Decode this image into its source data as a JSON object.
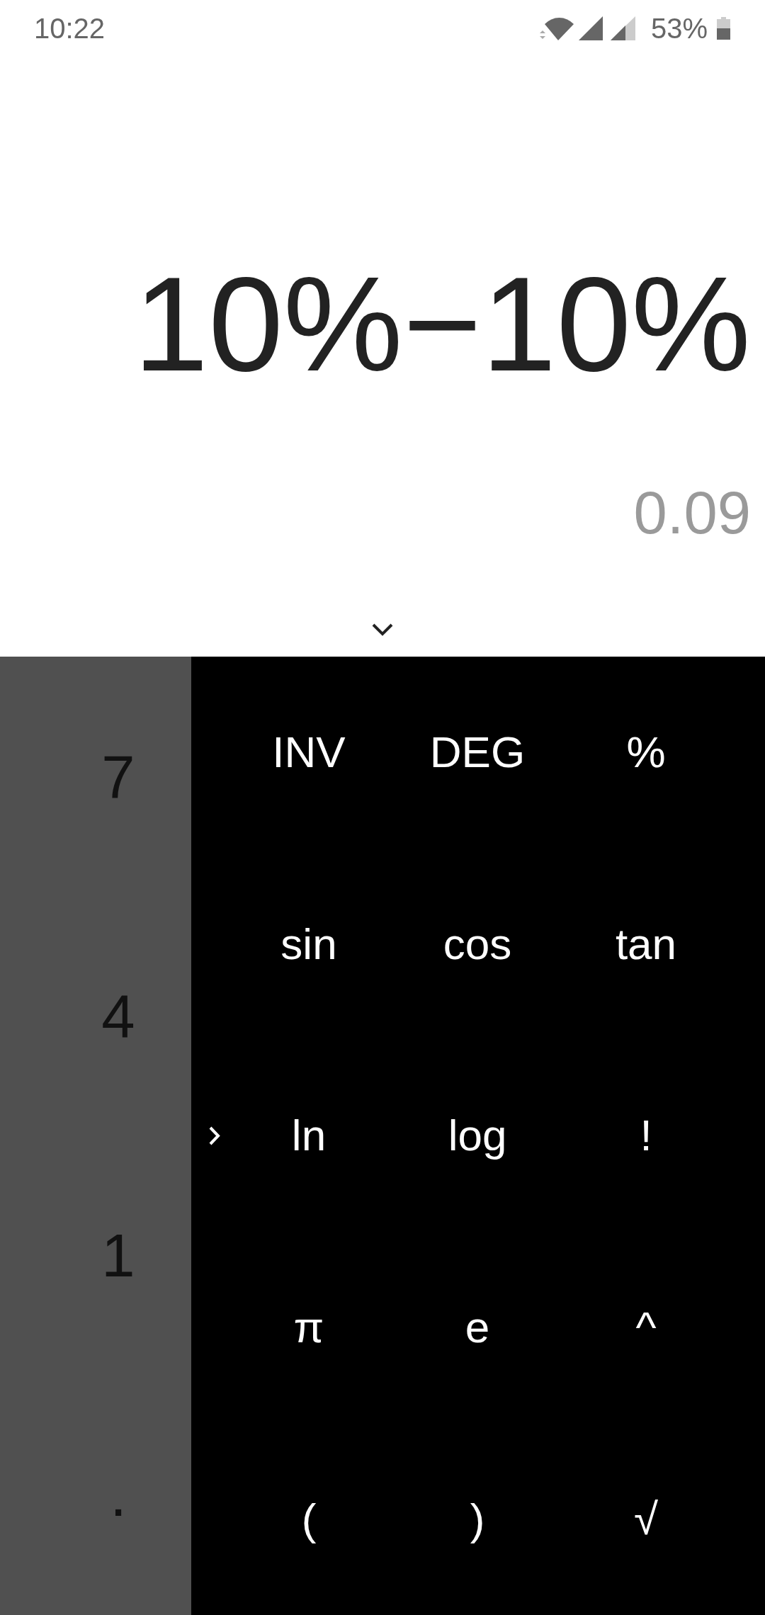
{
  "status_bar": {
    "time": "10:22",
    "battery": "53%"
  },
  "display": {
    "expression": "10%−10%",
    "result": "0.09"
  },
  "numpad": [
    "7",
    "4",
    "1",
    "."
  ],
  "advanced_panel": {
    "keys": [
      "INV",
      "DEG",
      "%",
      "sin",
      "cos",
      "tan",
      "ln",
      "log",
      "!",
      "π",
      "e",
      "^",
      "(",
      ")",
      "√"
    ]
  }
}
